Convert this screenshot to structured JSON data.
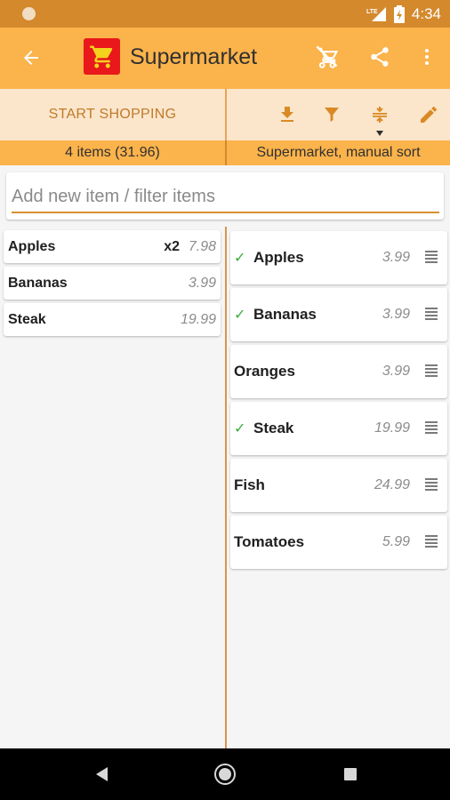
{
  "status_bar": {
    "network_label": "LTE",
    "time": "4:34"
  },
  "app_bar": {
    "title": "Supermarket",
    "icons": [
      "back-arrow-icon",
      "shopping-cart-logo-icon",
      "cart-remove-icon",
      "share-icon",
      "more-vert-icon"
    ]
  },
  "toolbar": {
    "start_label": "START SHOPPING",
    "icons": [
      "download-icon",
      "filter-icon",
      "collapse-icon",
      "edit-icon"
    ]
  },
  "summary": {
    "left": "4 items (31.96)",
    "right": "Supermarket, manual sort"
  },
  "new_item": {
    "placeholder": "Add new item / filter items",
    "value": ""
  },
  "shopping_list": [
    {
      "name": "Apples",
      "qty": "x2",
      "price": "7.98"
    },
    {
      "name": "Bananas",
      "qty": "",
      "price": "3.99"
    },
    {
      "name": "Steak",
      "qty": "",
      "price": "19.99"
    }
  ],
  "pantry_list": [
    {
      "name": "Apples",
      "price": "3.99",
      "checked": true
    },
    {
      "name": "Bananas",
      "price": "3.99",
      "checked": true
    },
    {
      "name": "Oranges",
      "price": "3.99",
      "checked": false
    },
    {
      "name": "Steak",
      "price": "19.99",
      "checked": true
    },
    {
      "name": "Fish",
      "price": "24.99",
      "checked": false
    },
    {
      "name": "Tomatoes",
      "price": "5.99",
      "checked": false
    }
  ],
  "check_mark": "✓",
  "colors": {
    "status_bar": "#d4892d",
    "app_bar": "#fbb34b",
    "toolbar_bg": "#fbe6cc",
    "accent_text": "#c07a28",
    "logo_red": "#e8181b",
    "check_green": "#3cab3c"
  },
  "nav_bar": {
    "icons": [
      "nav-back-icon",
      "nav-home-icon",
      "nav-recents-icon"
    ]
  }
}
